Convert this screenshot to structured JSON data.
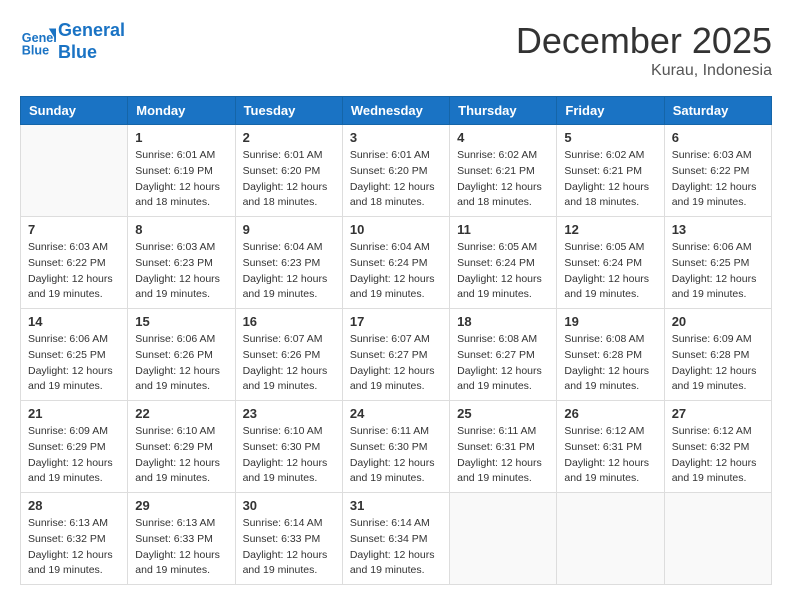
{
  "logo": {
    "line1": "General",
    "line2": "Blue"
  },
  "title": "December 2025",
  "location": "Kurau, Indonesia",
  "days_of_week": [
    "Sunday",
    "Monday",
    "Tuesday",
    "Wednesday",
    "Thursday",
    "Friday",
    "Saturday"
  ],
  "weeks": [
    [
      {
        "day": "",
        "sunrise": "",
        "sunset": "",
        "daylight": ""
      },
      {
        "day": "1",
        "sunrise": "Sunrise: 6:01 AM",
        "sunset": "Sunset: 6:19 PM",
        "daylight": "Daylight: 12 hours and 18 minutes."
      },
      {
        "day": "2",
        "sunrise": "Sunrise: 6:01 AM",
        "sunset": "Sunset: 6:20 PM",
        "daylight": "Daylight: 12 hours and 18 minutes."
      },
      {
        "day": "3",
        "sunrise": "Sunrise: 6:01 AM",
        "sunset": "Sunset: 6:20 PM",
        "daylight": "Daylight: 12 hours and 18 minutes."
      },
      {
        "day": "4",
        "sunrise": "Sunrise: 6:02 AM",
        "sunset": "Sunset: 6:21 PM",
        "daylight": "Daylight: 12 hours and 18 minutes."
      },
      {
        "day": "5",
        "sunrise": "Sunrise: 6:02 AM",
        "sunset": "Sunset: 6:21 PM",
        "daylight": "Daylight: 12 hours and 18 minutes."
      },
      {
        "day": "6",
        "sunrise": "Sunrise: 6:03 AM",
        "sunset": "Sunset: 6:22 PM",
        "daylight": "Daylight: 12 hours and 19 minutes."
      }
    ],
    [
      {
        "day": "7",
        "sunrise": "Sunrise: 6:03 AM",
        "sunset": "Sunset: 6:22 PM",
        "daylight": "Daylight: 12 hours and 19 minutes."
      },
      {
        "day": "8",
        "sunrise": "Sunrise: 6:03 AM",
        "sunset": "Sunset: 6:23 PM",
        "daylight": "Daylight: 12 hours and 19 minutes."
      },
      {
        "day": "9",
        "sunrise": "Sunrise: 6:04 AM",
        "sunset": "Sunset: 6:23 PM",
        "daylight": "Daylight: 12 hours and 19 minutes."
      },
      {
        "day": "10",
        "sunrise": "Sunrise: 6:04 AM",
        "sunset": "Sunset: 6:24 PM",
        "daylight": "Daylight: 12 hours and 19 minutes."
      },
      {
        "day": "11",
        "sunrise": "Sunrise: 6:05 AM",
        "sunset": "Sunset: 6:24 PM",
        "daylight": "Daylight: 12 hours and 19 minutes."
      },
      {
        "day": "12",
        "sunrise": "Sunrise: 6:05 AM",
        "sunset": "Sunset: 6:24 PM",
        "daylight": "Daylight: 12 hours and 19 minutes."
      },
      {
        "day": "13",
        "sunrise": "Sunrise: 6:06 AM",
        "sunset": "Sunset: 6:25 PM",
        "daylight": "Daylight: 12 hours and 19 minutes."
      }
    ],
    [
      {
        "day": "14",
        "sunrise": "Sunrise: 6:06 AM",
        "sunset": "Sunset: 6:25 PM",
        "daylight": "Daylight: 12 hours and 19 minutes."
      },
      {
        "day": "15",
        "sunrise": "Sunrise: 6:06 AM",
        "sunset": "Sunset: 6:26 PM",
        "daylight": "Daylight: 12 hours and 19 minutes."
      },
      {
        "day": "16",
        "sunrise": "Sunrise: 6:07 AM",
        "sunset": "Sunset: 6:26 PM",
        "daylight": "Daylight: 12 hours and 19 minutes."
      },
      {
        "day": "17",
        "sunrise": "Sunrise: 6:07 AM",
        "sunset": "Sunset: 6:27 PM",
        "daylight": "Daylight: 12 hours and 19 minutes."
      },
      {
        "day": "18",
        "sunrise": "Sunrise: 6:08 AM",
        "sunset": "Sunset: 6:27 PM",
        "daylight": "Daylight: 12 hours and 19 minutes."
      },
      {
        "day": "19",
        "sunrise": "Sunrise: 6:08 AM",
        "sunset": "Sunset: 6:28 PM",
        "daylight": "Daylight: 12 hours and 19 minutes."
      },
      {
        "day": "20",
        "sunrise": "Sunrise: 6:09 AM",
        "sunset": "Sunset: 6:28 PM",
        "daylight": "Daylight: 12 hours and 19 minutes."
      }
    ],
    [
      {
        "day": "21",
        "sunrise": "Sunrise: 6:09 AM",
        "sunset": "Sunset: 6:29 PM",
        "daylight": "Daylight: 12 hours and 19 minutes."
      },
      {
        "day": "22",
        "sunrise": "Sunrise: 6:10 AM",
        "sunset": "Sunset: 6:29 PM",
        "daylight": "Daylight: 12 hours and 19 minutes."
      },
      {
        "day": "23",
        "sunrise": "Sunrise: 6:10 AM",
        "sunset": "Sunset: 6:30 PM",
        "daylight": "Daylight: 12 hours and 19 minutes."
      },
      {
        "day": "24",
        "sunrise": "Sunrise: 6:11 AM",
        "sunset": "Sunset: 6:30 PM",
        "daylight": "Daylight: 12 hours and 19 minutes."
      },
      {
        "day": "25",
        "sunrise": "Sunrise: 6:11 AM",
        "sunset": "Sunset: 6:31 PM",
        "daylight": "Daylight: 12 hours and 19 minutes."
      },
      {
        "day": "26",
        "sunrise": "Sunrise: 6:12 AM",
        "sunset": "Sunset: 6:31 PM",
        "daylight": "Daylight: 12 hours and 19 minutes."
      },
      {
        "day": "27",
        "sunrise": "Sunrise: 6:12 AM",
        "sunset": "Sunset: 6:32 PM",
        "daylight": "Daylight: 12 hours and 19 minutes."
      }
    ],
    [
      {
        "day": "28",
        "sunrise": "Sunrise: 6:13 AM",
        "sunset": "Sunset: 6:32 PM",
        "daylight": "Daylight: 12 hours and 19 minutes."
      },
      {
        "day": "29",
        "sunrise": "Sunrise: 6:13 AM",
        "sunset": "Sunset: 6:33 PM",
        "daylight": "Daylight: 12 hours and 19 minutes."
      },
      {
        "day": "30",
        "sunrise": "Sunrise: 6:14 AM",
        "sunset": "Sunset: 6:33 PM",
        "daylight": "Daylight: 12 hours and 19 minutes."
      },
      {
        "day": "31",
        "sunrise": "Sunrise: 6:14 AM",
        "sunset": "Sunset: 6:34 PM",
        "daylight": "Daylight: 12 hours and 19 minutes."
      },
      {
        "day": "",
        "sunrise": "",
        "sunset": "",
        "daylight": ""
      },
      {
        "day": "",
        "sunrise": "",
        "sunset": "",
        "daylight": ""
      },
      {
        "day": "",
        "sunrise": "",
        "sunset": "",
        "daylight": ""
      }
    ]
  ]
}
